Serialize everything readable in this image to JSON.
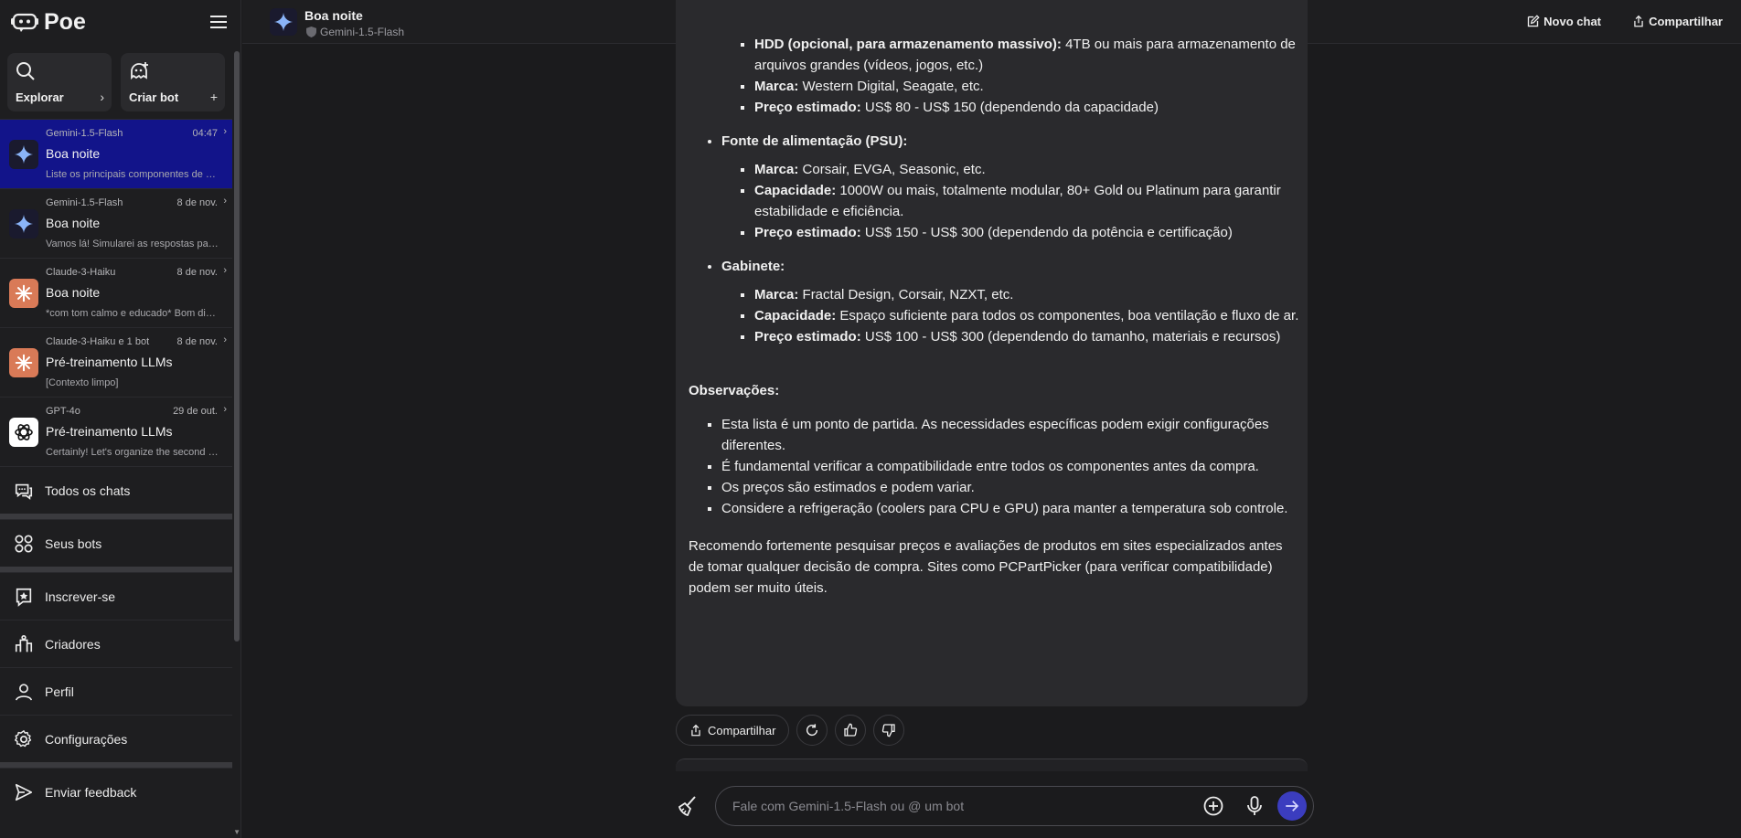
{
  "app": {
    "logo_text": "Poe"
  },
  "quick_actions": {
    "explore": {
      "label": "Explorar",
      "icon": "search-icon",
      "arrow": "›"
    },
    "create": {
      "label": "Criar bot",
      "icon": "add-bot-icon",
      "arrow": "+"
    }
  },
  "chats": [
    {
      "bot": "Gemini-1.5-Flash",
      "date": "04:47",
      "title": "Boa noite",
      "preview": "Liste os principais componentes de u...",
      "avatar": "gemini-icon",
      "active": true
    },
    {
      "bot": "Gemini-1.5-Flash",
      "date": "8 de nov.",
      "title": "Boa noite",
      "preview": "Vamos lá! Simularei as respostas para ...",
      "avatar": "gemini-icon",
      "active": false
    },
    {
      "bot": "Claude-3-Haiku",
      "date": "8 de nov.",
      "title": "Boa noite",
      "preview": "*com tom calmo e educado* Bom dia,...",
      "avatar": "claude-icon",
      "active": false
    },
    {
      "bot": "Claude-3-Haiku e 1 bot",
      "date": "8 de nov.",
      "title": "Pré-treinamento LLMs",
      "preview": "[Contexto limpo]",
      "avatar": "claude-icon",
      "active": false
    },
    {
      "bot": "GPT-4o",
      "date": "29 de out.",
      "title": "Pré-treinamento LLMs",
      "preview": "Certainly! Let's organize the second p...",
      "avatar": "openai-icon",
      "active": false
    }
  ],
  "nav": {
    "all_chats": "Todos os chats",
    "your_bots": "Seus bots",
    "subscribe": "Inscrever-se",
    "creators": "Criadores",
    "profile": "Perfil",
    "settings": "Configurações",
    "feedback": "Enviar feedback"
  },
  "header": {
    "title": "Boa noite",
    "subtitle": "Gemini-1.5-Flash",
    "new_chat": "Novo chat",
    "share": "Compartilhar"
  },
  "message": {
    "hdd": {
      "label": "HDD (opcional, para armazenamento massivo):",
      "text": " 4TB ou mais para armazenamento de arquivos grandes (vídeos, jogos, etc.)"
    },
    "hdd_brand": {
      "label": "Marca:",
      "text": " Western Digital, Seagate, etc."
    },
    "hdd_price": {
      "label": "Preço estimado:",
      "text": " US$ 80 - US$ 150 (dependendo da capacidade)"
    },
    "psu_title": "Fonte de alimentação (PSU):",
    "psu_brand": {
      "label": "Marca:",
      "text": " Corsair, EVGA, Seasonic, etc."
    },
    "psu_capacity": {
      "label": "Capacidade:",
      "text": " 1000W ou mais, totalmente modular, 80+ Gold ou Platinum para garantir estabilidade e eficiência."
    },
    "psu_price": {
      "label": "Preço estimado:",
      "text": " US$ 150 - US$ 300 (dependendo da potência e certificação)"
    },
    "case_title": "Gabinete:",
    "case_brand": {
      "label": "Marca:",
      "text": " Fractal Design, Corsair, NZXT, etc."
    },
    "case_capacity": {
      "label": "Capacidade:",
      "text": " Espaço suficiente para todos os componentes, boa ventilação e fluxo de ar."
    },
    "case_price": {
      "label": "Preço estimado:",
      "text": " US$ 100 - US$ 300 (dependendo do tamanho, materiais e recursos)"
    },
    "obs_title": "Observações:",
    "obs_items": [
      "Esta lista é um ponto de partida. As necessidades específicas podem exigir configurações diferentes.",
      "É fundamental verificar a compatibilidade entre todos os componentes antes da compra.",
      "Os preços são estimados e podem variar.",
      "Considere a refrigeração (coolers para CPU e GPU) para manter a temperatura sob controle."
    ],
    "closing": "Recomendo fortemente pesquisar preços e avaliações de produtos em sites especializados antes de tomar qualquer decisão de compra. Sites como PCPartPicker (para verificar compatibilidade) podem ser muito úteis."
  },
  "actions": {
    "share": "Compartilhar"
  },
  "input": {
    "placeholder": "Fale com Gemini-1.5-Flash ou @ um bot"
  },
  "colors": {
    "accent": "#3b3dbf",
    "active_chat": "#12148a",
    "claude": "#d97a57"
  }
}
